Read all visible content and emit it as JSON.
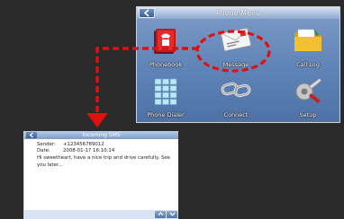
{
  "phone_menu": {
    "title": "Phone Menu",
    "apps": [
      {
        "label": "Phonebook",
        "icon": "phonebook-icon"
      },
      {
        "label": "Message",
        "icon": "message-envelope-icon"
      },
      {
        "label": "Call Log",
        "icon": "folder-call-log-icon"
      },
      {
        "label": "Phone Dialer",
        "icon": "dialer-keypad-icon"
      },
      {
        "label": "Connect",
        "icon": "chain-connect-icon"
      },
      {
        "label": "Setup",
        "icon": "wrench-setup-icon"
      }
    ]
  },
  "sms": {
    "title": "Incoming SMS",
    "sender_label": "Sender:",
    "sender_value": "+123456789012",
    "date_label": "Date:",
    "date_value": "2008-01-17 16:10:14",
    "message": "Hi sweetheart, have a nice trip and drive carefully. See you later..."
  },
  "colors": {
    "highlight": "#e01010",
    "menu_bg": "#5f83b6",
    "page_bg": "#2a2a2a"
  }
}
